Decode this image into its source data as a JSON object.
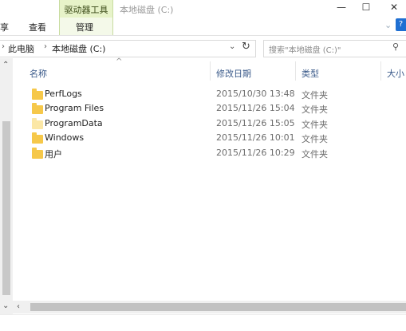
{
  "window": {
    "context_tab_label": "驱动器工具",
    "title": "本地磁盘 (C:)",
    "minimize_glyph": "—",
    "maximize_glyph": "☐",
    "close_glyph": "✕"
  },
  "ribbon": {
    "tabs": [
      "享",
      "查看",
      "管理"
    ],
    "help_glyph": "?"
  },
  "address": {
    "crumbs": [
      "此电脑",
      "本地磁盘 (C:)"
    ],
    "search_placeholder": "搜索\"本地磁盘 (C:)\""
  },
  "columns": [
    "名称",
    "修改日期",
    "类型",
    "大小"
  ],
  "files": [
    {
      "name": "PerfLogs",
      "modified": "2015/10/30 13:48",
      "type": "文件夹",
      "hidden": false
    },
    {
      "name": "Program Files",
      "modified": "2015/11/26 15:04",
      "type": "文件夹",
      "hidden": false
    },
    {
      "name": "ProgramData",
      "modified": "2015/11/26 15:05",
      "type": "文件夹",
      "hidden": true
    },
    {
      "name": "Windows",
      "modified": "2015/11/26 10:01",
      "type": "文件夹",
      "hidden": false
    },
    {
      "name": "用户",
      "modified": "2015/11/26 10:29",
      "type": "文件夹",
      "hidden": false
    }
  ],
  "colors": {
    "context_tab_bg": "#e7f3c9",
    "folder": "#f6c84a",
    "accent": "#1f6fd2"
  },
  "icons": {
    "folder": "folder-icon",
    "search": "search-icon",
    "refresh": "refresh-icon",
    "dropdown": "chevron-down-icon"
  }
}
